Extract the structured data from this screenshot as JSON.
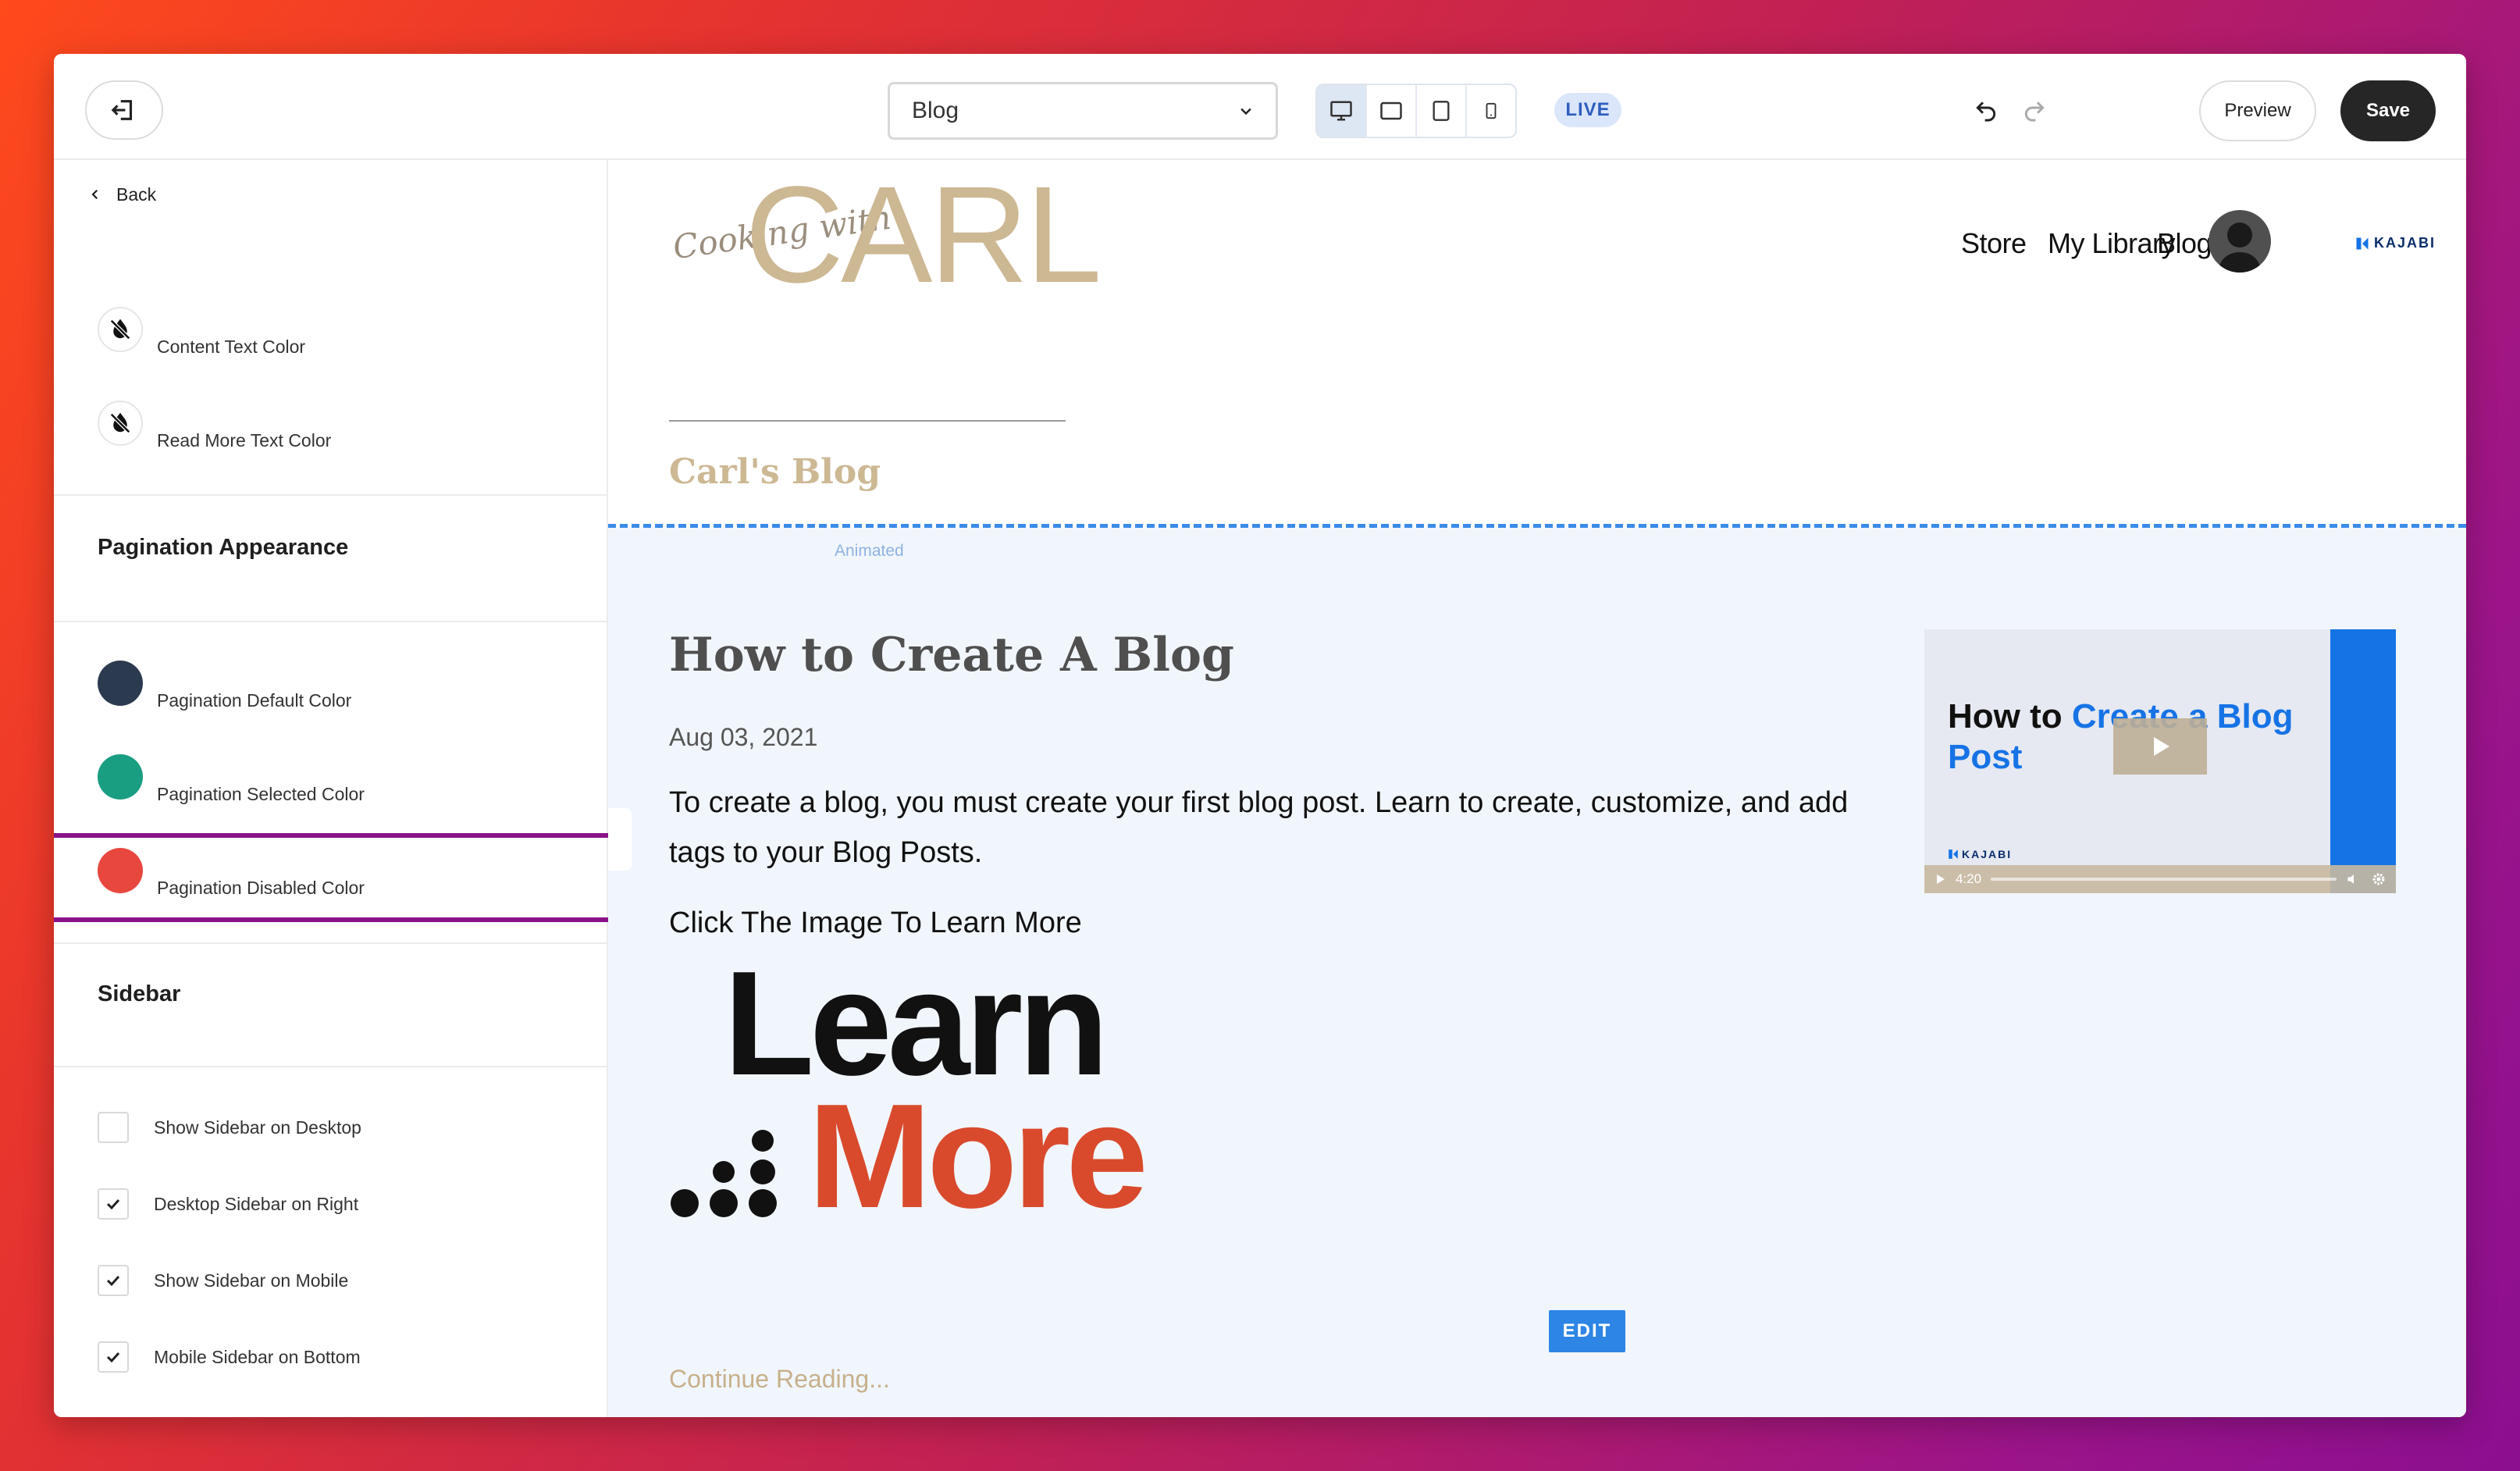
{
  "toolbar": {
    "page_select_value": "Blog",
    "live_badge": "LIVE",
    "preview_label": "Preview",
    "save_label": "Save"
  },
  "sidebar": {
    "back_label": "Back",
    "colors_top": [
      {
        "label": "Content Text Color",
        "value": "none"
      },
      {
        "label": "Read More Text Color",
        "value": "none"
      }
    ],
    "pagination": {
      "title": "Pagination Appearance",
      "items": [
        {
          "label": "Pagination Default Color",
          "color": "#2c3a4f"
        },
        {
          "label": "Pagination Selected Color",
          "color": "#1a9e82"
        },
        {
          "label": "Pagination Disabled Color",
          "color": "#e8473e"
        }
      ]
    },
    "sidebar_section": {
      "title": "Sidebar",
      "checks": [
        {
          "label": "Show Sidebar on Desktop",
          "checked": false
        },
        {
          "label": "Desktop Sidebar on Right",
          "checked": true
        },
        {
          "label": "Show Sidebar on Mobile",
          "checked": true
        },
        {
          "label": "Mobile Sidebar on Bottom",
          "checked": true
        }
      ]
    }
  },
  "site": {
    "logo_script": "Cooking with",
    "logo_big": "CARL",
    "nav": [
      "Store",
      "My Library",
      "Blog"
    ],
    "kajabi": "KAJABI",
    "blog_title": "Carl's Blog",
    "animated_label": "Animated",
    "post": {
      "title": "How to Create A Blog",
      "date": "Aug 03, 2021",
      "body": "To create a blog, you must create your first blog post. Learn to create, customize, and add tags to your Blog Posts.",
      "cta": "Click The Image  To Learn More",
      "image_text_1": "Learn",
      "image_text_2": "More",
      "edit_label": "EDIT",
      "continue_label": "Continue Reading..."
    },
    "video": {
      "title_black": "How to ",
      "title_blue": "Create a Blog Post",
      "brand": "KAJABI",
      "time": "4:20"
    }
  },
  "colors": {
    "accent_blue": "#2d85e5",
    "brand_tan": "#cdb894",
    "highlight_purple": "#8a1289"
  }
}
